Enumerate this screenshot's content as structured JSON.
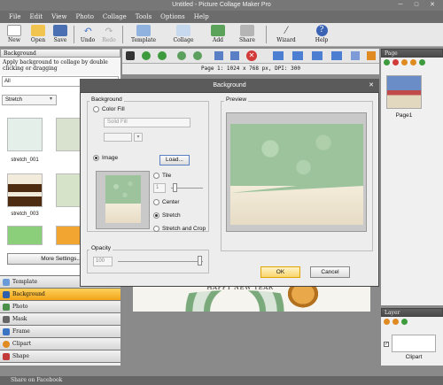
{
  "window": {
    "title": "Untitled - Picture Collage Maker Pro"
  },
  "menu": [
    "File",
    "Edit",
    "View",
    "Photo",
    "Collage",
    "Tools",
    "Options",
    "Help"
  ],
  "toolbar": {
    "new": "New",
    "open": "Open",
    "save": "Save",
    "undo": "Undo",
    "redo": "Redo",
    "template": "Template",
    "collage": "Collage",
    "add": "Add",
    "share": "Share",
    "wizard": "Wizard",
    "help": "Help"
  },
  "left_panel": {
    "header": "Background",
    "instruction": "Apply background to collage by double clicking or dragging",
    "filter_all": "All",
    "mode_select": "Stretch",
    "thumbs": [
      "stretch_001",
      "stretch_003"
    ],
    "more_settings": "More Settings..."
  },
  "left_tabs": [
    "Template",
    "Background",
    "Photo",
    "Mask",
    "Frame",
    "Clipart",
    "Shape"
  ],
  "status": {
    "page_info": "Page 1: 1024 x 768 px, DPI: 300"
  },
  "canvas": {
    "text": "HAPPY NEW YEAR"
  },
  "pages_panel": {
    "header": "Page",
    "page_label": "Page1"
  },
  "layer_panel": {
    "header": "Layer",
    "item_label": "Clipart"
  },
  "share_bar": {
    "label": "Share on Facebook"
  },
  "dialog": {
    "title": "Background",
    "group_background": "Background",
    "color_fill_label": "Color Fill",
    "fill_select": "Solid Fill",
    "image_label": "Image",
    "load_button": "Load...",
    "tile_label": "Tile",
    "tile_value": "1",
    "center_label": "Center",
    "stretch_label": "Stretch",
    "stretch_crop_label": "Stretch and Crop",
    "preview_label": "Preview",
    "opacity_label": "Opacity",
    "opacity_value": "100",
    "ok_button": "OK",
    "cancel_button": "Cancel"
  },
  "colors": {
    "accent": "#f3a81c",
    "titlebar": "#777777",
    "dialog_title": "#5b5b5b",
    "bg_green": "#9cc39b"
  }
}
